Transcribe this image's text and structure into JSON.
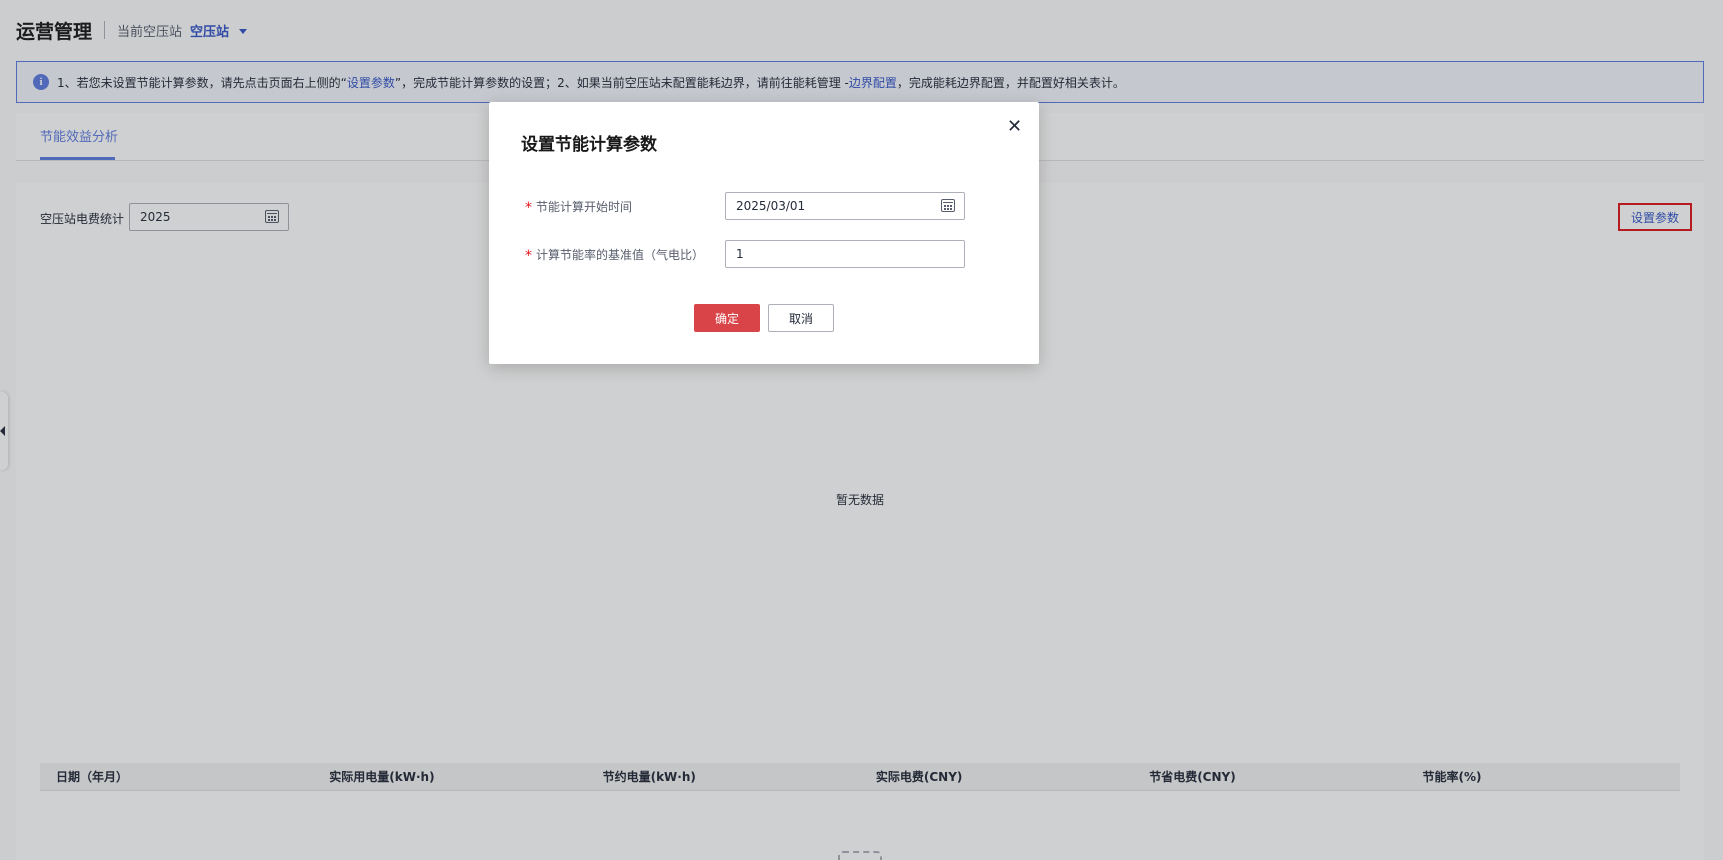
{
  "header": {
    "title": "运营管理",
    "station_label": "当前空压站",
    "station_value": "空压站"
  },
  "notice": {
    "text_part1": "1、若您未设置节能计算参数，请先点击页面右上侧的“",
    "link1": "设置参数",
    "text_part2": "”，完成节能计算参数的设置；2、如果当前空压站未配置能耗边界，请前往能耗管理 - ",
    "link2": "边界配置",
    "text_part3": "，完成能耗边界配置，并配置好相关表计。"
  },
  "tabs": [
    {
      "label": "节能效益分析",
      "active": true
    }
  ],
  "panel": {
    "stat_label": "空压站电费统计",
    "year_value": "2025",
    "set_params_label": "设置参数",
    "empty_text": "暂无数据"
  },
  "table": {
    "columns": [
      "日期（年月）",
      "实际用电量(kW·h)",
      "节约电量(kW·h)",
      "实际电费(CNY)",
      "节省电费(CNY)",
      "节能率(%)"
    ]
  },
  "modal": {
    "title": "设置节能计算参数",
    "close_icon": "close-icon",
    "fields": [
      {
        "label": "节能计算开始时间",
        "value": "2025/03/01",
        "required": true
      },
      {
        "label": "计算节能率的基准值（气电比）",
        "value": "1",
        "required": true
      }
    ],
    "ok_label": "确定",
    "cancel_label": "取消"
  },
  "colors": {
    "accent": "#5e7ce0",
    "link": "#3455c8",
    "danger_button": "#d94449",
    "highlight_border": "#e0161e"
  }
}
